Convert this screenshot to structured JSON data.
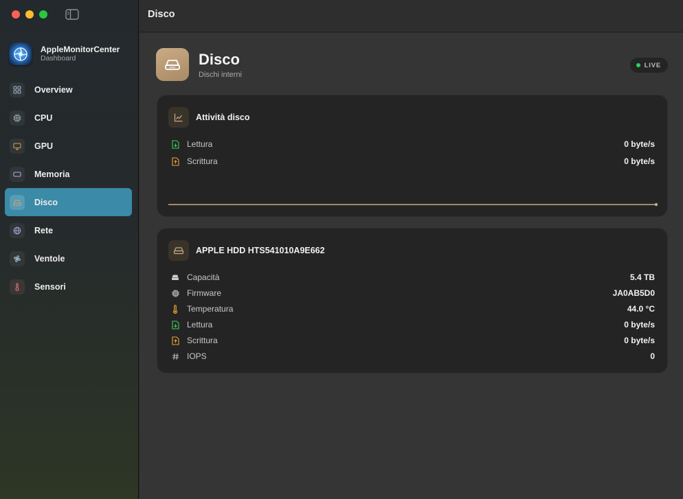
{
  "sidebar": {
    "app_title": "AppleMonitorCenter",
    "app_subtitle": "Dashboard",
    "items": [
      {
        "label": "Overview",
        "icon": "grid-icon",
        "color": "#8fa3b8"
      },
      {
        "label": "CPU",
        "icon": "cpu-icon",
        "color": "#8fa3a8"
      },
      {
        "label": "GPU",
        "icon": "monitor-icon",
        "color": "#d59a4a"
      },
      {
        "label": "Memoria",
        "icon": "memory-icon",
        "color": "#b7a3d8"
      },
      {
        "label": "Disco",
        "icon": "drive-icon",
        "color": "#c9a57a"
      },
      {
        "label": "Rete",
        "icon": "globe-icon",
        "color": "#a3a3d8"
      },
      {
        "label": "Ventole",
        "icon": "fan-icon",
        "color": "#a3c3d8"
      },
      {
        "label": "Sensori",
        "icon": "thermometer-icon",
        "color": "#e07a7a"
      }
    ],
    "active_index": 4
  },
  "topbar": {
    "title": "Disco"
  },
  "header": {
    "title": "Disco",
    "subtitle": "Dischi interni",
    "badge": "LIVE"
  },
  "activity_card": {
    "title": "Attività disco",
    "rows": [
      {
        "label": "Lettura",
        "value": "0 byte/s",
        "icon": "doc-in-icon",
        "color": "#3fce5a"
      },
      {
        "label": "Scrittura",
        "value": "0 byte/s",
        "icon": "doc-out-icon",
        "color": "#f2a23a"
      }
    ]
  },
  "disk_card": {
    "title": "APPLE HDD HTS541010A9E662",
    "rows": [
      {
        "label": "Capacità",
        "value": "5.4 TB",
        "icon": "drive-icon",
        "color": "#cfcfcf"
      },
      {
        "label": "Firmware",
        "value": "JA0AB5D0",
        "icon": "chip-icon",
        "color": "#cfcfcf"
      },
      {
        "label": "Temperatura",
        "value": "44.0 °C",
        "icon": "thermometer-icon",
        "color": "#f2a23a"
      },
      {
        "label": "Lettura",
        "value": "0 byte/s",
        "icon": "doc-in-icon",
        "color": "#3fce5a"
      },
      {
        "label": "Scrittura",
        "value": "0 byte/s",
        "icon": "doc-out-icon",
        "color": "#f2a23a"
      },
      {
        "label": "IOPS",
        "value": "0",
        "icon": "hash-icon",
        "color": "#bdbdbd"
      }
    ]
  },
  "colors": {
    "accent": "#3a8aa8",
    "disk": "#c9ab85",
    "live": "#2fd158"
  }
}
